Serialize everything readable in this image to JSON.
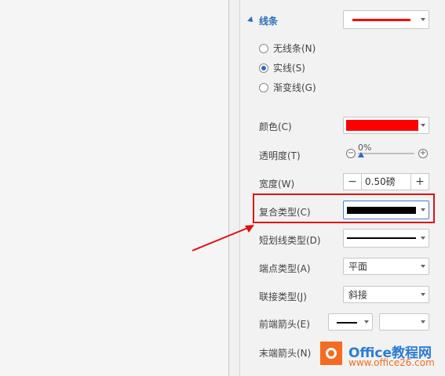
{
  "panel": {
    "section_title": "线条",
    "line_preview_color": "#ff0000",
    "radios": [
      {
        "label": "无线条(N)",
        "checked": false
      },
      {
        "label": "实线(S)",
        "checked": true
      },
      {
        "label": "渐变线(G)",
        "checked": false
      }
    ],
    "color": {
      "label": "颜色(C)",
      "value": "#ff0000"
    },
    "transparency": {
      "label": "透明度(T)",
      "value": "0%",
      "minus": "−",
      "plus": "+"
    },
    "width": {
      "label": "宽度(W)",
      "value": "0.50磅",
      "minus": "−",
      "plus": "+"
    },
    "compound_type": {
      "label": "复合类型(C)"
    },
    "dash_type": {
      "label": "短划线类型(D)"
    },
    "cap_type": {
      "label": "端点类型(A)",
      "value": "平面"
    },
    "join_type": {
      "label": "联接类型(J)",
      "value": "斜接"
    },
    "begin_arrow": {
      "label": "前端箭头(E)"
    },
    "end_arrow": {
      "label": "末端箭头(N)"
    }
  },
  "watermark": {
    "title": "Office教程网",
    "subtitle": "www.office26.com"
  },
  "colors": {
    "highlight": "#e21010",
    "accent": "#2a6ebb"
  }
}
